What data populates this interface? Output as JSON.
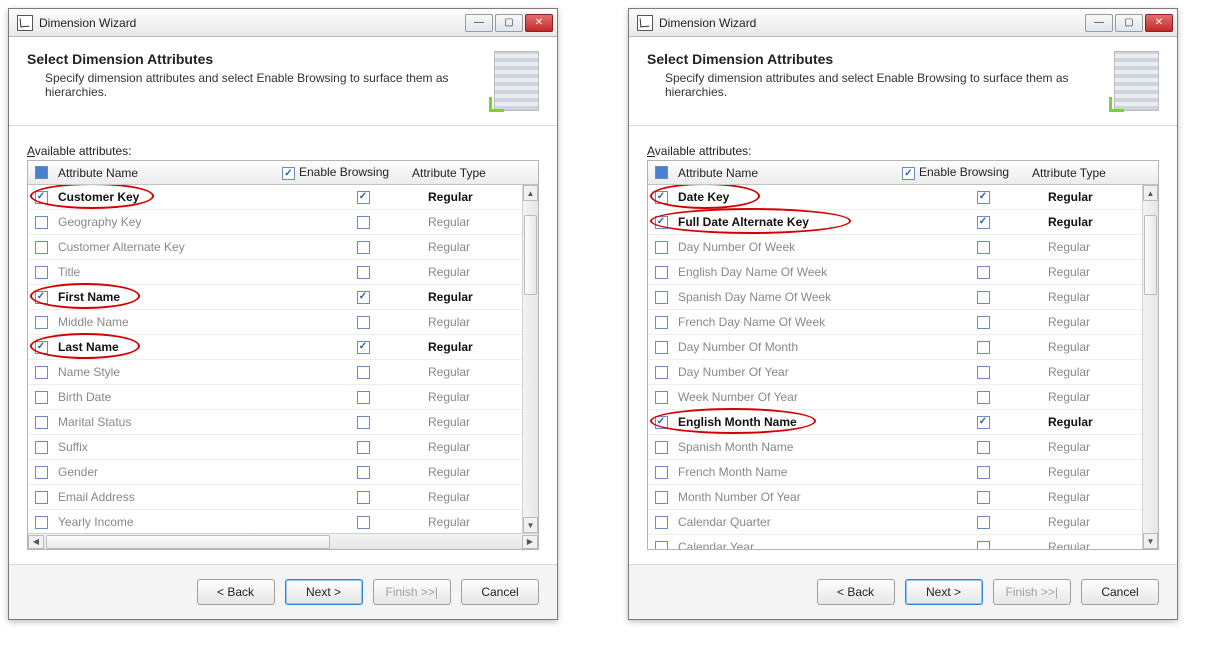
{
  "windows": [
    {
      "title": "Dimension Wizard",
      "heading": "Select Dimension Attributes",
      "subheading": "Specify dimension attributes and select Enable Browsing to surface them as hierarchies.",
      "available_label_prefix": "A",
      "available_label_rest": "vailable attributes:",
      "col_attr_name": "Attribute Name",
      "col_enable_browsing": "Enable Browsing",
      "col_attr_type": "Attribute Type",
      "show_hscroll": true,
      "rows": [
        {
          "name": "Customer Key",
          "checked": true,
          "eb": true,
          "type": "Regular",
          "bold": true,
          "circle": true
        },
        {
          "name": "Geography Key",
          "checked": false,
          "eb": false,
          "type": "Regular",
          "dim": true
        },
        {
          "name": "Customer Alternate Key",
          "checked": false,
          "eb": false,
          "type": "Regular",
          "dim": true
        },
        {
          "name": "Title",
          "checked": false,
          "eb": false,
          "type": "Regular",
          "dim": true
        },
        {
          "name": "First Name",
          "checked": true,
          "eb": true,
          "type": "Regular",
          "bold": true,
          "circle": true
        },
        {
          "name": "Middle Name",
          "checked": false,
          "eb": false,
          "type": "Regular",
          "dim": true
        },
        {
          "name": "Last Name",
          "checked": true,
          "eb": true,
          "type": "Regular",
          "bold": true,
          "circle": true
        },
        {
          "name": "Name Style",
          "checked": false,
          "eb": false,
          "type": "Regular",
          "dim": true
        },
        {
          "name": "Birth Date",
          "checked": false,
          "eb": false,
          "type": "Regular",
          "dim": true
        },
        {
          "name": "Marital Status",
          "checked": false,
          "eb": false,
          "type": "Regular",
          "dim": true
        },
        {
          "name": "Suffix",
          "checked": false,
          "eb": false,
          "type": "Regular",
          "dim": true
        },
        {
          "name": "Gender",
          "checked": false,
          "eb": false,
          "type": "Regular",
          "dim": true
        },
        {
          "name": "Email Address",
          "checked": false,
          "eb": false,
          "type": "Regular",
          "dim": true
        },
        {
          "name": "Yearly Income",
          "checked": false,
          "eb": false,
          "type": "Regular",
          "dim": true
        }
      ],
      "buttons": {
        "back": "< Back",
        "next": "Next >",
        "finish": "Finish >>|",
        "cancel": "Cancel"
      }
    },
    {
      "title": "Dimension Wizard",
      "heading": "Select Dimension Attributes",
      "subheading": "Specify dimension attributes and select Enable Browsing to surface them as hierarchies.",
      "available_label_prefix": "A",
      "available_label_rest": "vailable attributes:",
      "col_attr_name": "Attribute Name",
      "col_enable_browsing": "Enable Browsing",
      "col_attr_type": "Attribute Type",
      "show_hscroll": false,
      "rows": [
        {
          "name": "Date Key",
          "checked": true,
          "eb": true,
          "type": "Regular",
          "bold": true,
          "circle": true
        },
        {
          "name": "Full Date Alternate Key",
          "checked": true,
          "eb": true,
          "type": "Regular",
          "bold": true,
          "circle": true
        },
        {
          "name": "Day Number Of Week",
          "checked": false,
          "eb": false,
          "type": "Regular",
          "dim": true
        },
        {
          "name": "English Day Name Of Week",
          "checked": false,
          "eb": false,
          "type": "Regular",
          "dim": true
        },
        {
          "name": "Spanish Day Name Of Week",
          "checked": false,
          "eb": false,
          "type": "Regular",
          "dim": true
        },
        {
          "name": "French Day Name Of Week",
          "checked": false,
          "eb": false,
          "type": "Regular",
          "dim": true
        },
        {
          "name": "Day Number Of Month",
          "checked": false,
          "eb": false,
          "type": "Regular",
          "dim": true
        },
        {
          "name": "Day Number Of Year",
          "checked": false,
          "eb": false,
          "type": "Regular",
          "dim": true
        },
        {
          "name": "Week Number Of Year",
          "checked": false,
          "eb": false,
          "type": "Regular",
          "dim": true
        },
        {
          "name": "English Month Name",
          "checked": true,
          "eb": true,
          "type": "Regular",
          "bold": true,
          "circle": true
        },
        {
          "name": "Spanish Month Name",
          "checked": false,
          "eb": false,
          "type": "Regular",
          "dim": true
        },
        {
          "name": "French Month Name",
          "checked": false,
          "eb": false,
          "type": "Regular",
          "dim": true
        },
        {
          "name": "Month Number Of Year",
          "checked": false,
          "eb": false,
          "type": "Regular",
          "dim": true
        },
        {
          "name": "Calendar Quarter",
          "checked": false,
          "eb": false,
          "type": "Regular",
          "dim": true
        },
        {
          "name": "Calendar Year",
          "checked": false,
          "eb": false,
          "type": "Regular",
          "dim": true
        }
      ],
      "buttons": {
        "back": "< Back",
        "next": "Next >",
        "finish": "Finish >>|",
        "cancel": "Cancel"
      }
    }
  ]
}
